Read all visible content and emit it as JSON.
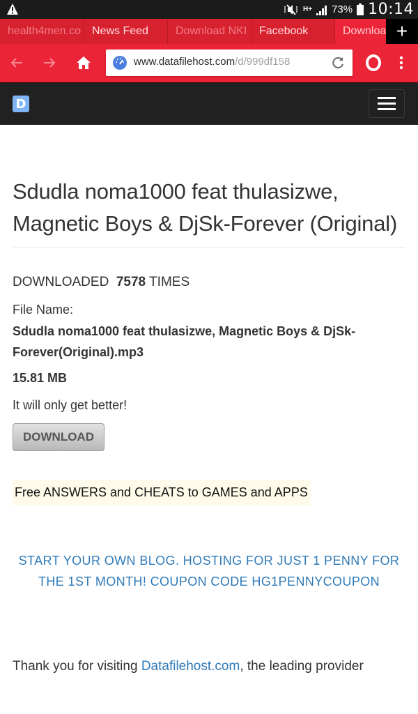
{
  "status_bar": {
    "warning_icon": "warning-triangle-icon",
    "battery_percent": "73%",
    "time": "10:14",
    "network_type": "H+"
  },
  "tabs": [
    {
      "label": "health4men.co",
      "state": "dim"
    },
    {
      "label": "News Feed",
      "state": "bright"
    },
    {
      "label": "Download NKI",
      "state": "dim"
    },
    {
      "label": "Facebook",
      "state": "bright"
    },
    {
      "label": "Downloa",
      "state": "active"
    }
  ],
  "tab_add_label": "+",
  "toolbar": {
    "url_host": "www.datafilehost.com",
    "url_path": "/d/999df158"
  },
  "colors": {
    "browser_red": "#ec2437",
    "link_blue": "#2f7ab8",
    "nav_dark": "#212121"
  },
  "site": {
    "logo_letter": "D"
  },
  "page": {
    "title": "Sdudla noma1000 feat thulasizwe, Magnetic Boys & DjSk-Forever (Original)",
    "downloaded_prefix": "DOWNLOADED",
    "download_count": "7578",
    "downloaded_suffix": "TIMES",
    "file_name_label": "File Name:",
    "file_name": "Sdudla noma1000 feat thulasizwe, Magnetic Boys & DjSk-Forever(Original).mp3",
    "file_size": "15.81 MB",
    "tagline": "It will only get better!",
    "download_button": "DOWNLOAD",
    "promo_text": "Free ANSWERS and CHEATS to GAMES and APPS",
    "blog_ad": "START YOUR OWN BLOG. HOSTING FOR JUST 1 PENNY FOR THE 1ST MONTH! COUPON CODE HG1PENNYCOUPON",
    "thanks_prefix": "Thank you for visiting ",
    "thanks_link": "Datafilehost.com",
    "thanks_suffix": ", the leading provider"
  }
}
